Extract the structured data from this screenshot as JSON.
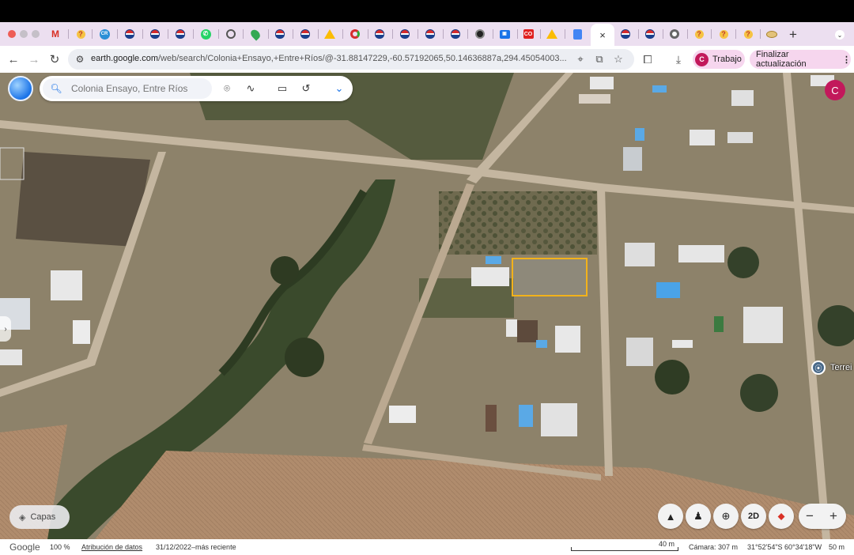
{
  "browser": {
    "active_tab_close": "×",
    "new_tab": "+",
    "url_host": "earth.google.com",
    "url_path": "/web/search/Colonia+Ensayo,+Entre+Ríos/@-31.88147229,-60.57192065,50.14636887a,294.45054003...",
    "profile_initial": "C",
    "profile_name": "Trabajo",
    "update_label": "Finalizar actualización"
  },
  "earth": {
    "search_placeholder": "Colonia Ensayo, Entre Ríos",
    "user_initial": "C",
    "place_label": "Terrei",
    "layers_label": "Capas",
    "view_mode": "2D",
    "zoom_out": "−",
    "zoom_in": "+"
  },
  "status": {
    "google": "Google",
    "zoom": "100 %",
    "attribution": "Atribución de datos",
    "imagery_date": "31/12/2022–más reciente",
    "scale": "40 m",
    "camera": "Cámara: 307 m",
    "coords": "31°52'54\"S 60°34'18\"W",
    "elevation": "50 m"
  },
  "colors": {
    "accent": "#1a73e8",
    "profile": "#c2185b",
    "parcel_outline": "#f2b21b"
  },
  "icons": [
    "gmail-icon",
    "help-icon",
    "remax-icon",
    "crm-icon",
    "whatsapp-icon",
    "globe-icon",
    "maps-icon",
    "drive-icon",
    "docs-icon",
    "chrome-icon",
    "search-icon",
    "pin-icon",
    "path-icon",
    "ruler-icon",
    "history-icon",
    "chevron-down-icon",
    "compass-icon",
    "pegman-icon",
    "my-location-icon",
    "layers-icon"
  ]
}
